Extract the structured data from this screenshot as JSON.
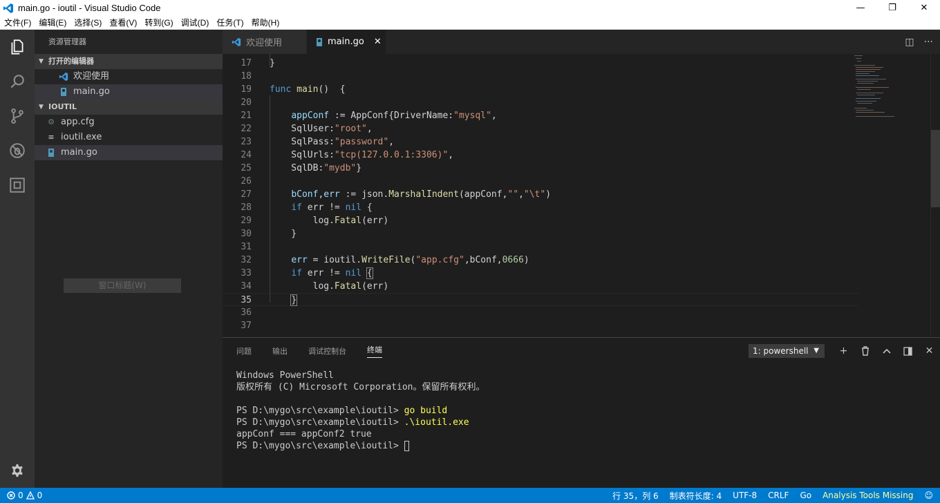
{
  "window": {
    "title": "main.go - ioutil - Visual Studio Code",
    "buttons": {
      "minimize": "—",
      "maximize": "❐",
      "close": "✕"
    }
  },
  "menu": [
    "文件(F)",
    "编辑(E)",
    "选择(S)",
    "查看(V)",
    "转到(G)",
    "调试(D)",
    "任务(T)",
    "帮助(H)"
  ],
  "activity_bar": {
    "items": [
      "files-icon",
      "search-icon",
      "source-control-icon",
      "debug-icon",
      "extensions-icon"
    ],
    "bottom": "gear-icon"
  },
  "sidebar": {
    "title": "资源管理器",
    "open_editors": {
      "heading": "打开的编辑器",
      "items": [
        {
          "label": "欢迎使用",
          "icon": "vscode-icon"
        },
        {
          "label": "main.go",
          "icon": "go-file-icon"
        }
      ]
    },
    "folder": {
      "heading": "IOUTIL",
      "items": [
        {
          "label": "app.cfg",
          "icon": "config-gear-icon"
        },
        {
          "label": "ioutil.exe",
          "icon": "exe-icon"
        },
        {
          "label": "main.go",
          "icon": "go-file-icon"
        }
      ]
    },
    "tooltip": "窗口标题(W)"
  },
  "tabs": [
    {
      "label": "欢迎使用",
      "active": false
    },
    {
      "label": "main.go",
      "active": true,
      "close": "✕"
    }
  ],
  "tab_actions": {
    "split": "◫",
    "more": "···"
  },
  "editor": {
    "lines": [
      {
        "n": "17",
        "code": "}"
      },
      {
        "n": "18",
        "code": ""
      },
      {
        "n": "19",
        "code": "func main()  {"
      },
      {
        "n": "20",
        "code": ""
      },
      {
        "n": "21",
        "code": "    appConf := AppConf{DriverName:\"mysql\","
      },
      {
        "n": "22",
        "code": "    SqlUser:\"root\","
      },
      {
        "n": "23",
        "code": "    SqlPass:\"password\","
      },
      {
        "n": "24",
        "code": "    SqlUrls:\"tcp(127.0.0.1:3306)\","
      },
      {
        "n": "25",
        "code": "    SqlDB:\"mydb\"}"
      },
      {
        "n": "26",
        "code": ""
      },
      {
        "n": "27",
        "code": "    bConf,err := json.MarshalIndent(appConf,\"\",\"\\t\")"
      },
      {
        "n": "28",
        "code": "    if err != nil {"
      },
      {
        "n": "29",
        "code": "        log.Fatal(err)"
      },
      {
        "n": "30",
        "code": "    }"
      },
      {
        "n": "31",
        "code": ""
      },
      {
        "n": "32",
        "code": "    err = ioutil.WriteFile(\"app.cfg\",bConf,0666)"
      },
      {
        "n": "33",
        "code": "    if err != nil {"
      },
      {
        "n": "34",
        "code": "        log.Fatal(err)"
      },
      {
        "n": "35",
        "code": "    }"
      },
      {
        "n": "36",
        "code": ""
      },
      {
        "n": "37",
        "code": ""
      }
    ],
    "current_line": "35"
  },
  "panel": {
    "tabs": [
      "问题",
      "输出",
      "调试控制台",
      "终端"
    ],
    "active_tab": "终端",
    "terminal_select": "1: powershell",
    "buttons": {
      "add": "+",
      "delete": "🗑",
      "maximize": "⌃",
      "split": "◧",
      "close": "✕"
    },
    "terminal": [
      {
        "prompt": "Windows PowerShell",
        "cmd": ""
      },
      {
        "prompt": "版权所有 (C) Microsoft Corporation。保留所有权利。",
        "cmd": ""
      },
      {
        "prompt": "",
        "cmd": ""
      },
      {
        "prompt": "PS D:\\mygo\\src\\example\\ioutil> ",
        "cmd": "go build"
      },
      {
        "prompt": "PS D:\\mygo\\src\\example\\ioutil> ",
        "cmd": ".\\ioutil.exe"
      },
      {
        "prompt": "appConf === appConf2 true",
        "cmd": ""
      },
      {
        "prompt": "PS D:\\mygo\\src\\example\\ioutil> ",
        "cmd": ""
      }
    ]
  },
  "statusbar": {
    "errors": "0",
    "warnings": "0",
    "position": "行 35，列 6",
    "tab_size": "制表符长度: 4",
    "encoding": "UTF-8",
    "eol": "CRLF",
    "language": "Go",
    "analysis": "Analysis Tools Missing",
    "feedback": "☺"
  },
  "colors": {
    "statusbar": "#007acc",
    "activity_bar": "#333333",
    "sidebar": "#252526",
    "editor_bg": "#1e1e1e",
    "keyword": "#569cd6",
    "string": "#ce9178",
    "function": "#dcdcaa",
    "variable": "#9cdcfe",
    "number": "#b5cea8",
    "terminal_command": "#ffff55"
  }
}
